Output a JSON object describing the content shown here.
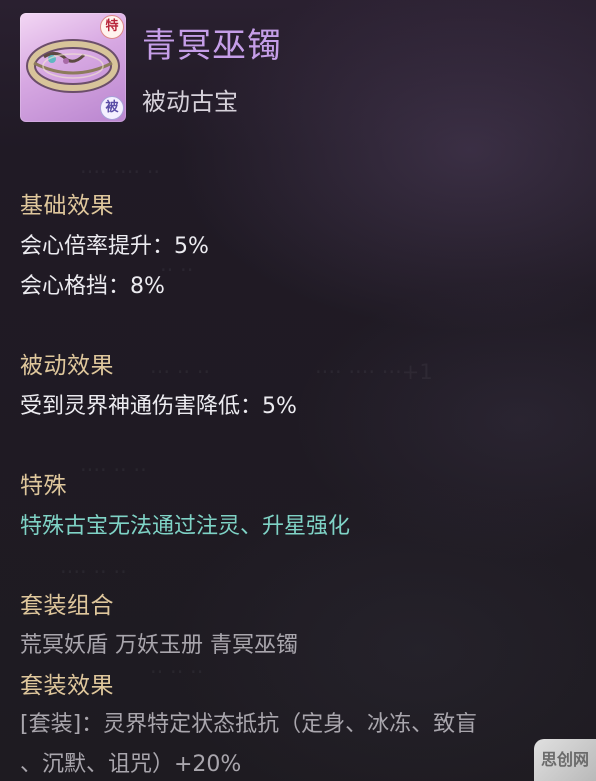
{
  "header": {
    "item_name": "青冥巫镯",
    "item_type": "被动古宝",
    "badge_special": "特",
    "badge_passive": "被"
  },
  "sections": {
    "basic": {
      "title": "基础效果",
      "lines": [
        "会心倍率提升：5%",
        "会心格挡：8%"
      ]
    },
    "passive": {
      "title": "被动效果",
      "lines": [
        "受到灵界神通伤害降低：5%"
      ]
    },
    "special": {
      "title": "特殊",
      "lines": [
        "特殊古宝无法通过注灵、升星强化"
      ]
    },
    "set_combo": {
      "title": "套装组合",
      "lines": [
        "荒冥妖盾 万妖玉册 青冥巫镯"
      ]
    },
    "set_effect": {
      "title": "套装效果",
      "lines": [
        "[套装]：灵界特定状态抵抗（定身、冰冻、致盲",
        "、沉默、诅咒）+20%"
      ]
    }
  },
  "watermark": {
    "text": "思创网"
  },
  "colors": {
    "title": "#c59ee8",
    "section_heading": "#dfc79c",
    "special_text": "#7fd3c6",
    "body_text": "#ecebf0"
  },
  "icons": [
    "bracelet-icon",
    "special-badge-icon",
    "passive-badge-icon"
  ]
}
